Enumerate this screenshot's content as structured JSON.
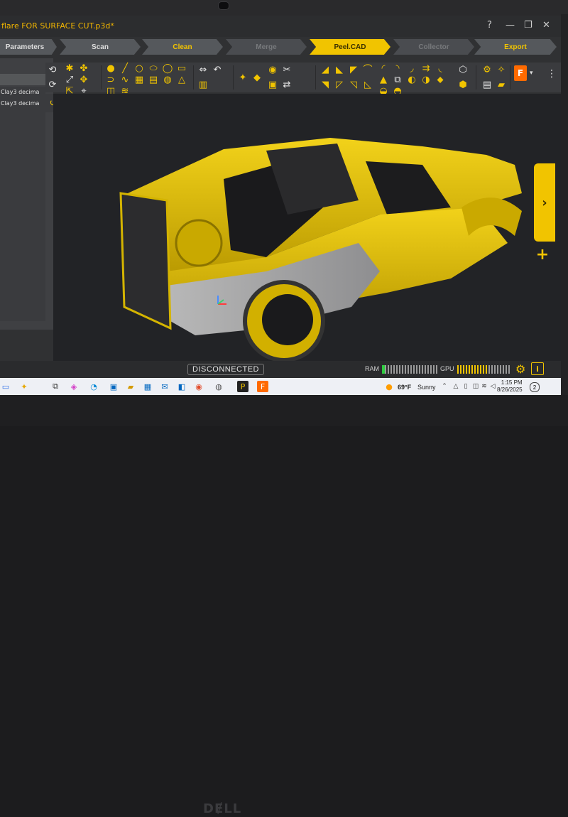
{
  "window": {
    "title": "flare FOR SURFACE CUT.p3d*",
    "controls": {
      "help": "?",
      "minimize": "—",
      "maximize": "❐",
      "close": "✕"
    }
  },
  "workflow": {
    "steps": [
      {
        "label": "Parameters",
        "state": "normal"
      },
      {
        "label": "Scan",
        "state": "normal"
      },
      {
        "label": "Clean",
        "state": "current"
      },
      {
        "label": "Merge",
        "state": "disabled"
      },
      {
        "label": "Peel.CAD",
        "state": "active"
      },
      {
        "label": "Collector",
        "state": "disabled"
      },
      {
        "label": "Export",
        "state": "export"
      }
    ]
  },
  "left_panel": {
    "rows": [
      "Clay3 decima",
      "Clay3 decima"
    ]
  },
  "viewport": {
    "side_tab_label": "›",
    "add_label": "+"
  },
  "status": {
    "connection": "DISCONNECTED",
    "ram_label": "RAM",
    "gpu_label": "GPU",
    "ram_level": 0.05,
    "gpu_level": 0.55,
    "settings_icon": "gear-icon",
    "info_icon": "info-icon"
  },
  "taskbar": {
    "weather_temp": "69°F",
    "weather_desc": "Sunny",
    "time": "1:15 PM",
    "date": "8/26/2025",
    "notification_count": "2"
  },
  "colors": {
    "accent": "#f1c400",
    "app_bg": "#303133",
    "viewport_bg": "#222326"
  }
}
